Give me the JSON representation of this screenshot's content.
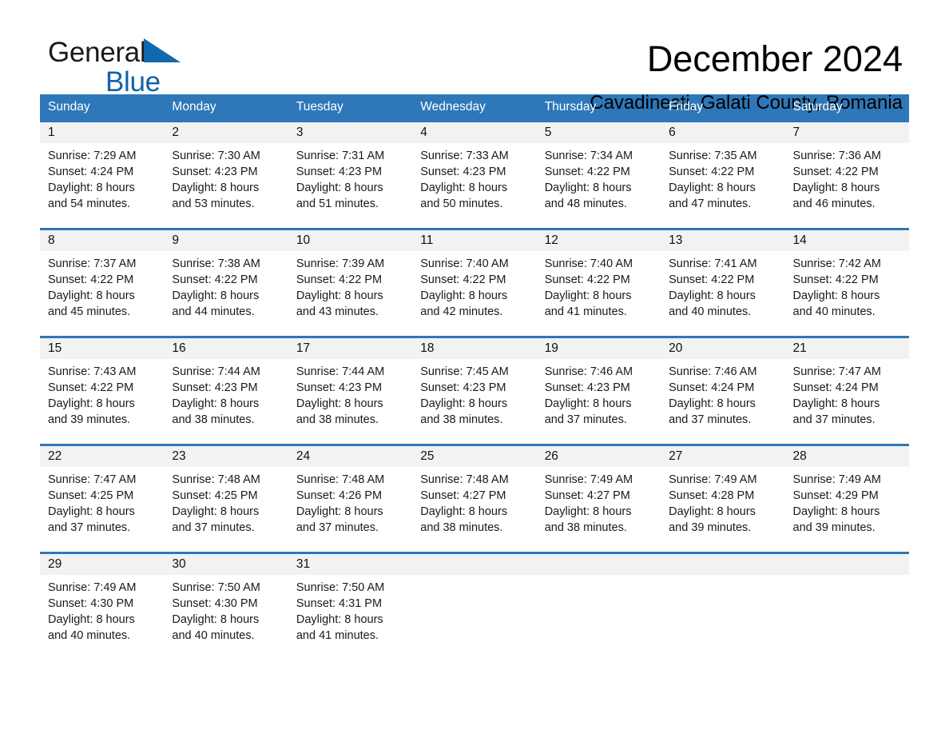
{
  "brand": {
    "name_part1": "General",
    "name_part2": "Blue",
    "triangle_color": "#1268ad"
  },
  "header": {
    "title": "December 2024",
    "subtitle": "Cavadinesti, Galati County, Romania"
  },
  "theme": {
    "header_blue": "#2e77b8",
    "daynum_band": "#f2f2f2",
    "text": "#1a1a1a"
  },
  "calendar": {
    "weekday_headers": [
      "Sunday",
      "Monday",
      "Tuesday",
      "Wednesday",
      "Thursday",
      "Friday",
      "Saturday"
    ],
    "weeks": [
      [
        {
          "day": "1",
          "sunrise": "Sunrise: 7:29 AM",
          "sunset": "Sunset: 4:24 PM",
          "daylight1": "Daylight: 8 hours",
          "daylight2": "and 54 minutes."
        },
        {
          "day": "2",
          "sunrise": "Sunrise: 7:30 AM",
          "sunset": "Sunset: 4:23 PM",
          "daylight1": "Daylight: 8 hours",
          "daylight2": "and 53 minutes."
        },
        {
          "day": "3",
          "sunrise": "Sunrise: 7:31 AM",
          "sunset": "Sunset: 4:23 PM",
          "daylight1": "Daylight: 8 hours",
          "daylight2": "and 51 minutes."
        },
        {
          "day": "4",
          "sunrise": "Sunrise: 7:33 AM",
          "sunset": "Sunset: 4:23 PM",
          "daylight1": "Daylight: 8 hours",
          "daylight2": "and 50 minutes."
        },
        {
          "day": "5",
          "sunrise": "Sunrise: 7:34 AM",
          "sunset": "Sunset: 4:22 PM",
          "daylight1": "Daylight: 8 hours",
          "daylight2": "and 48 minutes."
        },
        {
          "day": "6",
          "sunrise": "Sunrise: 7:35 AM",
          "sunset": "Sunset: 4:22 PM",
          "daylight1": "Daylight: 8 hours",
          "daylight2": "and 47 minutes."
        },
        {
          "day": "7",
          "sunrise": "Sunrise: 7:36 AM",
          "sunset": "Sunset: 4:22 PM",
          "daylight1": "Daylight: 8 hours",
          "daylight2": "and 46 minutes."
        }
      ],
      [
        {
          "day": "8",
          "sunrise": "Sunrise: 7:37 AM",
          "sunset": "Sunset: 4:22 PM",
          "daylight1": "Daylight: 8 hours",
          "daylight2": "and 45 minutes."
        },
        {
          "day": "9",
          "sunrise": "Sunrise: 7:38 AM",
          "sunset": "Sunset: 4:22 PM",
          "daylight1": "Daylight: 8 hours",
          "daylight2": "and 44 minutes."
        },
        {
          "day": "10",
          "sunrise": "Sunrise: 7:39 AM",
          "sunset": "Sunset: 4:22 PM",
          "daylight1": "Daylight: 8 hours",
          "daylight2": "and 43 minutes."
        },
        {
          "day": "11",
          "sunrise": "Sunrise: 7:40 AM",
          "sunset": "Sunset: 4:22 PM",
          "daylight1": "Daylight: 8 hours",
          "daylight2": "and 42 minutes."
        },
        {
          "day": "12",
          "sunrise": "Sunrise: 7:40 AM",
          "sunset": "Sunset: 4:22 PM",
          "daylight1": "Daylight: 8 hours",
          "daylight2": "and 41 minutes."
        },
        {
          "day": "13",
          "sunrise": "Sunrise: 7:41 AM",
          "sunset": "Sunset: 4:22 PM",
          "daylight1": "Daylight: 8 hours",
          "daylight2": "and 40 minutes."
        },
        {
          "day": "14",
          "sunrise": "Sunrise: 7:42 AM",
          "sunset": "Sunset: 4:22 PM",
          "daylight1": "Daylight: 8 hours",
          "daylight2": "and 40 minutes."
        }
      ],
      [
        {
          "day": "15",
          "sunrise": "Sunrise: 7:43 AM",
          "sunset": "Sunset: 4:22 PM",
          "daylight1": "Daylight: 8 hours",
          "daylight2": "and 39 minutes."
        },
        {
          "day": "16",
          "sunrise": "Sunrise: 7:44 AM",
          "sunset": "Sunset: 4:23 PM",
          "daylight1": "Daylight: 8 hours",
          "daylight2": "and 38 minutes."
        },
        {
          "day": "17",
          "sunrise": "Sunrise: 7:44 AM",
          "sunset": "Sunset: 4:23 PM",
          "daylight1": "Daylight: 8 hours",
          "daylight2": "and 38 minutes."
        },
        {
          "day": "18",
          "sunrise": "Sunrise: 7:45 AM",
          "sunset": "Sunset: 4:23 PM",
          "daylight1": "Daylight: 8 hours",
          "daylight2": "and 38 minutes."
        },
        {
          "day": "19",
          "sunrise": "Sunrise: 7:46 AM",
          "sunset": "Sunset: 4:23 PM",
          "daylight1": "Daylight: 8 hours",
          "daylight2": "and 37 minutes."
        },
        {
          "day": "20",
          "sunrise": "Sunrise: 7:46 AM",
          "sunset": "Sunset: 4:24 PM",
          "daylight1": "Daylight: 8 hours",
          "daylight2": "and 37 minutes."
        },
        {
          "day": "21",
          "sunrise": "Sunrise: 7:47 AM",
          "sunset": "Sunset: 4:24 PM",
          "daylight1": "Daylight: 8 hours",
          "daylight2": "and 37 minutes."
        }
      ],
      [
        {
          "day": "22",
          "sunrise": "Sunrise: 7:47 AM",
          "sunset": "Sunset: 4:25 PM",
          "daylight1": "Daylight: 8 hours",
          "daylight2": "and 37 minutes."
        },
        {
          "day": "23",
          "sunrise": "Sunrise: 7:48 AM",
          "sunset": "Sunset: 4:25 PM",
          "daylight1": "Daylight: 8 hours",
          "daylight2": "and 37 minutes."
        },
        {
          "day": "24",
          "sunrise": "Sunrise: 7:48 AM",
          "sunset": "Sunset: 4:26 PM",
          "daylight1": "Daylight: 8 hours",
          "daylight2": "and 37 minutes."
        },
        {
          "day": "25",
          "sunrise": "Sunrise: 7:48 AM",
          "sunset": "Sunset: 4:27 PM",
          "daylight1": "Daylight: 8 hours",
          "daylight2": "and 38 minutes."
        },
        {
          "day": "26",
          "sunrise": "Sunrise: 7:49 AM",
          "sunset": "Sunset: 4:27 PM",
          "daylight1": "Daylight: 8 hours",
          "daylight2": "and 38 minutes."
        },
        {
          "day": "27",
          "sunrise": "Sunrise: 7:49 AM",
          "sunset": "Sunset: 4:28 PM",
          "daylight1": "Daylight: 8 hours",
          "daylight2": "and 39 minutes."
        },
        {
          "day": "28",
          "sunrise": "Sunrise: 7:49 AM",
          "sunset": "Sunset: 4:29 PM",
          "daylight1": "Daylight: 8 hours",
          "daylight2": "and 39 minutes."
        }
      ],
      [
        {
          "day": "29",
          "sunrise": "Sunrise: 7:49 AM",
          "sunset": "Sunset: 4:30 PM",
          "daylight1": "Daylight: 8 hours",
          "daylight2": "and 40 minutes."
        },
        {
          "day": "30",
          "sunrise": "Sunrise: 7:50 AM",
          "sunset": "Sunset: 4:30 PM",
          "daylight1": "Daylight: 8 hours",
          "daylight2": "and 40 minutes."
        },
        {
          "day": "31",
          "sunrise": "Sunrise: 7:50 AM",
          "sunset": "Sunset: 4:31 PM",
          "daylight1": "Daylight: 8 hours",
          "daylight2": "and 41 minutes."
        },
        {
          "day": "",
          "sunrise": "",
          "sunset": "",
          "daylight1": "",
          "daylight2": ""
        },
        {
          "day": "",
          "sunrise": "",
          "sunset": "",
          "daylight1": "",
          "daylight2": ""
        },
        {
          "day": "",
          "sunrise": "",
          "sunset": "",
          "daylight1": "",
          "daylight2": ""
        },
        {
          "day": "",
          "sunrise": "",
          "sunset": "",
          "daylight1": "",
          "daylight2": ""
        }
      ]
    ]
  }
}
